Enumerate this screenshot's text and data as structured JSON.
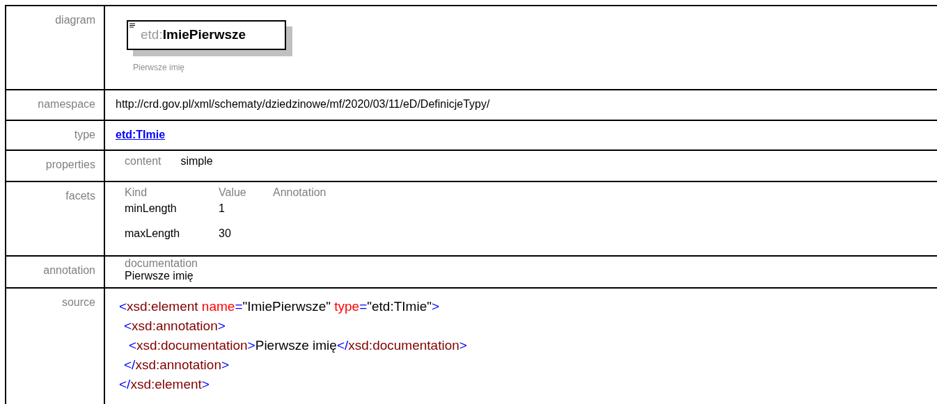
{
  "diagram": {
    "label": "diagram",
    "element_prefix": "etd:",
    "element_name": "ImiePierwsze",
    "caption": "Pierwsze imię"
  },
  "namespace": {
    "label": "namespace",
    "value": "http://crd.gov.pl/xml/schematy/dziedzinowe/mf/2020/03/11/eD/DefinicjeTypy/"
  },
  "type": {
    "label": "type",
    "link": "etd:TImie"
  },
  "properties": {
    "label": "properties",
    "items": [
      {
        "key": "content",
        "value": "simple"
      }
    ]
  },
  "facets": {
    "label": "facets",
    "columns": [
      "Kind",
      "Value",
      "Annotation"
    ],
    "rows": [
      {
        "kind": "minLength",
        "value": "1"
      },
      {
        "kind": "maxLength",
        "value": "30"
      }
    ]
  },
  "annotation": {
    "label": "annotation",
    "heading": "documentation",
    "text": "Pierwsze imię"
  },
  "source": {
    "label": "source",
    "lines": [
      {
        "tokens": [
          {
            "kind": "bracket",
            "text": "<"
          },
          {
            "kind": "tag",
            "text": "xsd:element"
          },
          {
            "kind": "attr",
            "text": " name"
          },
          {
            "kind": "bracket",
            "text": "="
          },
          {
            "kind": "text",
            "text": "\"ImiePierwsze\""
          },
          {
            "kind": "attr",
            "text": " type"
          },
          {
            "kind": "bracket",
            "text": "="
          },
          {
            "kind": "text",
            "text": "\"etd:TImie\""
          },
          {
            "kind": "bracket",
            "text": ">"
          }
        ],
        "children": [
          {
            "tokens": [
              {
                "kind": "bracket",
                "text": "<"
              },
              {
                "kind": "tag",
                "text": "xsd:annotation"
              },
              {
                "kind": "bracket",
                "text": ">"
              }
            ],
            "children": [
              {
                "tokens": [
                  {
                    "kind": "bracket",
                    "text": "<"
                  },
                  {
                    "kind": "tag",
                    "text": "xsd:documentation"
                  },
                  {
                    "kind": "bracket",
                    "text": ">"
                  },
                  {
                    "kind": "text",
                    "text": "Pierwsze imię"
                  },
                  {
                    "kind": "bracket",
                    "text": "</"
                  },
                  {
                    "kind": "tag",
                    "text": "xsd:documentation"
                  },
                  {
                    "kind": "bracket",
                    "text": ">"
                  }
                ]
              }
            ]
          },
          {
            "tokens": [
              {
                "kind": "bracket",
                "text": "</"
              },
              {
                "kind": "tag",
                "text": "xsd:annotation"
              },
              {
                "kind": "bracket",
                "text": ">"
              }
            ]
          }
        ]
      },
      {
        "tokens": [
          {
            "kind": "bracket",
            "text": "</"
          },
          {
            "kind": "tag",
            "text": "xsd:element"
          },
          {
            "kind": "bracket",
            "text": ">"
          }
        ]
      }
    ]
  }
}
